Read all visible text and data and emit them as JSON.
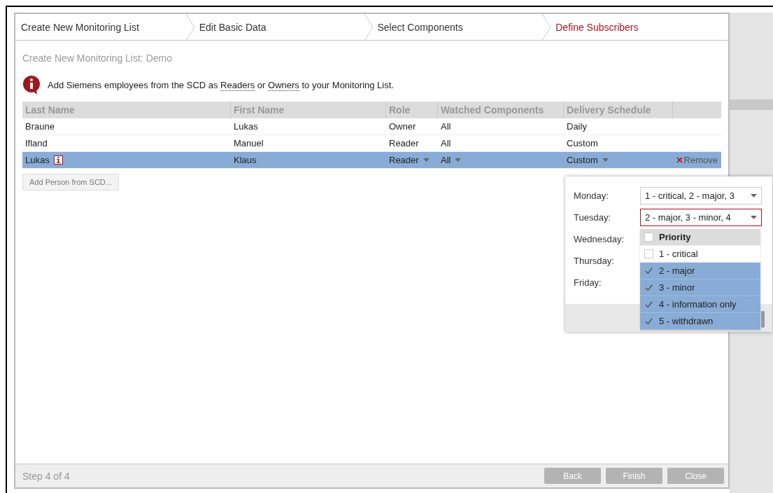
{
  "steps": [
    {
      "label": "Create New Monitoring List",
      "selected": false
    },
    {
      "label": "Edit Basic Data",
      "selected": false
    },
    {
      "label": "Select Components",
      "selected": false
    },
    {
      "label": "Define Subscribers",
      "selected": true
    }
  ],
  "subtitle": "Create New Monitoring List: Demo",
  "info": [
    {
      "kind": "text",
      "text": "Add Siemens employees from the SCD as "
    },
    {
      "kind": "link",
      "text": "Readers"
    },
    {
      "kind": "text",
      "text": " or "
    },
    {
      "kind": "link",
      "text": "Owners"
    },
    {
      "kind": "text",
      "text": " to your Monitoring List."
    }
  ],
  "table": {
    "columns": [
      "Last Name",
      "First Name",
      "Role",
      "Watched Components",
      "Delivery Schedule"
    ],
    "rows": [
      {
        "cells": [
          "Braune",
          "Lukas",
          "Owner",
          "All",
          "Daily"
        ],
        "selected": false,
        "has_info": false
      },
      {
        "cells": [
          "Ifland",
          "Manuel",
          "Reader",
          "All",
          "Custom"
        ],
        "selected": false,
        "has_info": false
      },
      {
        "cells": [
          "Lukas",
          "Klaus",
          "Reader",
          "All",
          "Custom"
        ],
        "selected": true,
        "has_info": true,
        "remove": "Remove"
      }
    ]
  },
  "add_button": "Add Person from SCD...",
  "schedule": {
    "days": [
      {
        "label": "Monday:",
        "value": "1 - critical, 2 - major, 3",
        "open": false
      },
      {
        "label": "Tuesday:",
        "value": "2 - major, 3 - minor, 4",
        "open": true
      },
      {
        "label": "Wednesday:"
      },
      {
        "label": "Thursday:"
      },
      {
        "label": "Friday:"
      }
    ],
    "dropdown": {
      "header": {
        "label": "Priority",
        "checked": false
      },
      "options": [
        {
          "label": "1 - critical",
          "checked": false
        },
        {
          "label": "2 - major",
          "checked": true
        },
        {
          "label": "3 - minor",
          "checked": true
        },
        {
          "label": "4 - information only",
          "checked": true
        },
        {
          "label": "5 - withdrawn",
          "checked": true
        }
      ]
    }
  },
  "footer": {
    "step": "Step 4 of 4",
    "buttons": [
      "Back",
      "Finish",
      "Close"
    ]
  }
}
